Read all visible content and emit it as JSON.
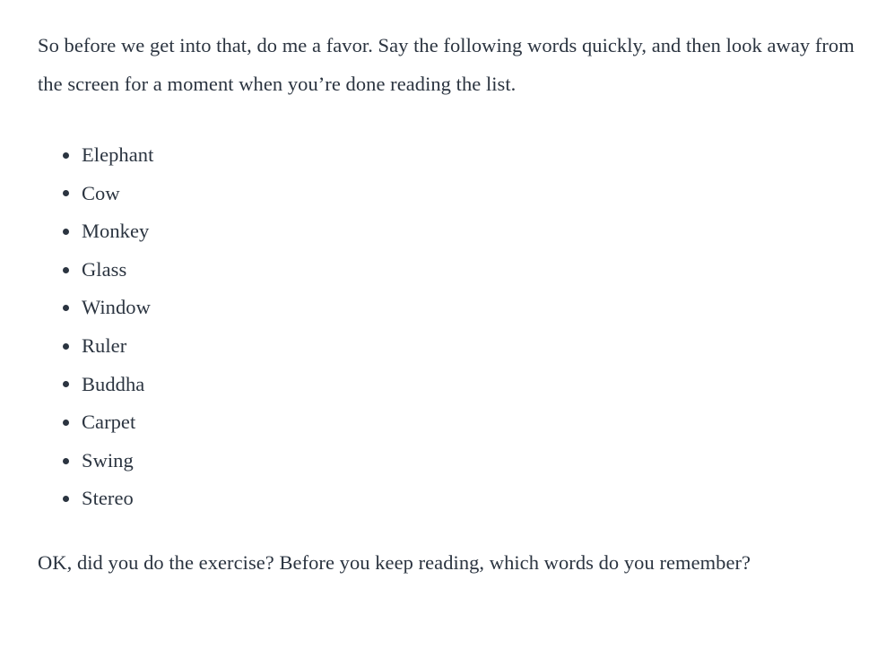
{
  "document": {
    "background_color": "#ffffff",
    "text_color": "#2b3440",
    "intro_paragraph": "So before we get into that, do me a favor. Say the following words quickly, and then look away from the screen for a moment when you’re done reading the list.",
    "word_list": [
      {
        "label": "Elephant"
      },
      {
        "label": "Cow"
      },
      {
        "label": "Monkey"
      },
      {
        "label": "Glass"
      },
      {
        "label": "Window"
      },
      {
        "label": "Ruler"
      },
      {
        "label": "Buddha"
      },
      {
        "label": "Carpet"
      },
      {
        "label": "Swing"
      },
      {
        "label": "Stereo"
      }
    ],
    "outro_paragraph": "OK, did you do the exercise? Before you keep reading, which words do you remember?"
  }
}
